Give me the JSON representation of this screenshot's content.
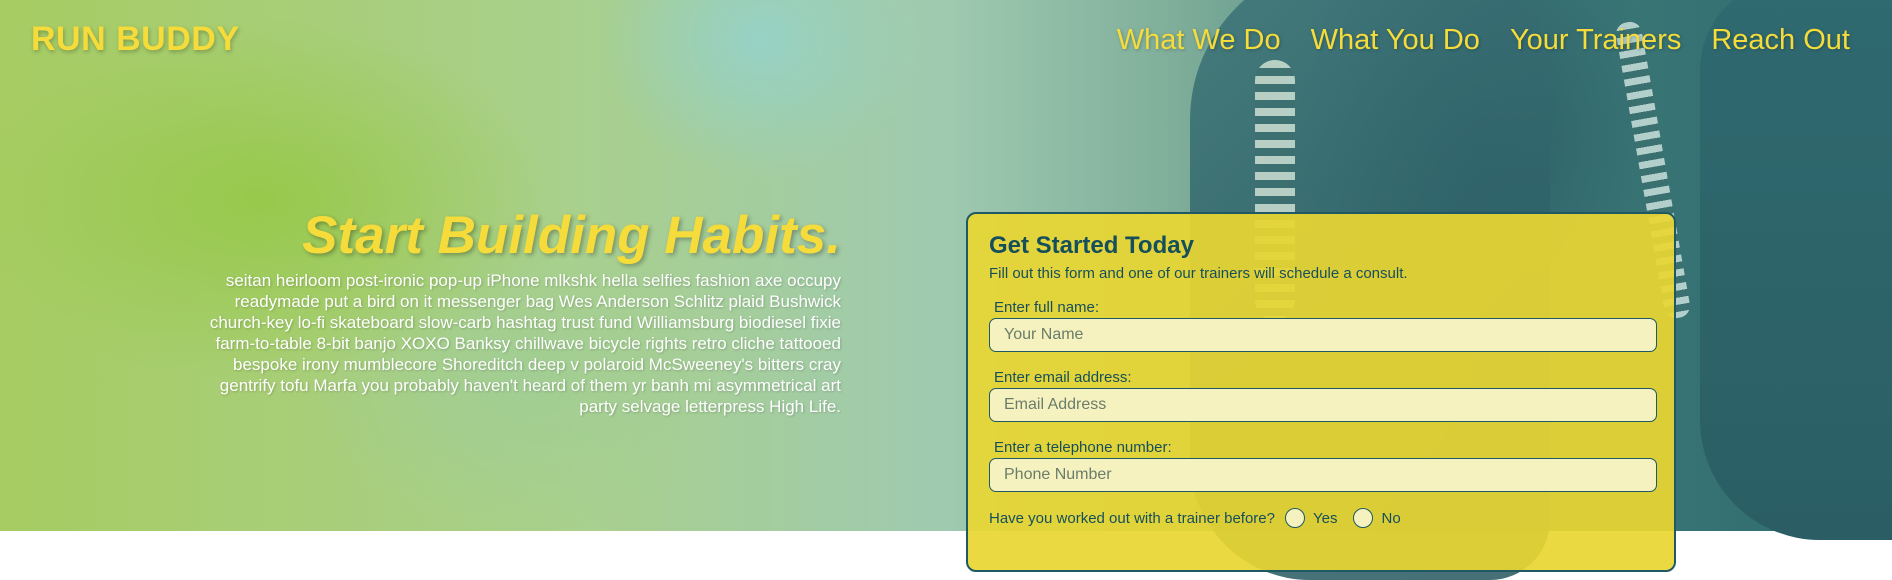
{
  "header": {
    "logo": "RUN BUDDY",
    "nav": [
      {
        "label": "What We Do"
      },
      {
        "label": "What You Do"
      },
      {
        "label": "Your Trainers"
      },
      {
        "label": "Reach Out"
      }
    ]
  },
  "intro": {
    "title": "Start Building Habits.",
    "body": "seitan heirloom post-ironic pop-up iPhone mlkshk hella selfies fashion axe occupy readymade put a bird on it messenger bag Wes Anderson Schlitz plaid Bushwick church-key lo-fi skateboard slow-carb hashtag trust fund Williamsburg biodiesel fixie farm-to-table 8-bit banjo XOXO Banksy chillwave bicycle rights retro cliche tattooed bespoke irony mumblecore Shoreditch deep v polaroid McSweeney's bitters cray gentrify tofu Marfa you probably haven't heard of them yr banh mi asymmetrical art party selvage letterpress High Life."
  },
  "form": {
    "title": "Get Started Today",
    "subtitle": "Fill out this form and one of our trainers will schedule a consult.",
    "fields": [
      {
        "label": "Enter full name:",
        "placeholder": "Your Name",
        "value": ""
      },
      {
        "label": "Enter email address:",
        "placeholder": "Email Address",
        "value": ""
      },
      {
        "label": "Enter a telephone number:",
        "placeholder": "Phone Number",
        "value": ""
      }
    ],
    "trainer_question": "Have you worked out with a trainer before?",
    "options": [
      {
        "label": "Yes"
      },
      {
        "label": "No"
      }
    ]
  },
  "colors": {
    "accent": "#f5dc3a",
    "form_bg": "#e9d632",
    "form_text": "#164f5c",
    "input_bg": "#f6f2c0"
  }
}
